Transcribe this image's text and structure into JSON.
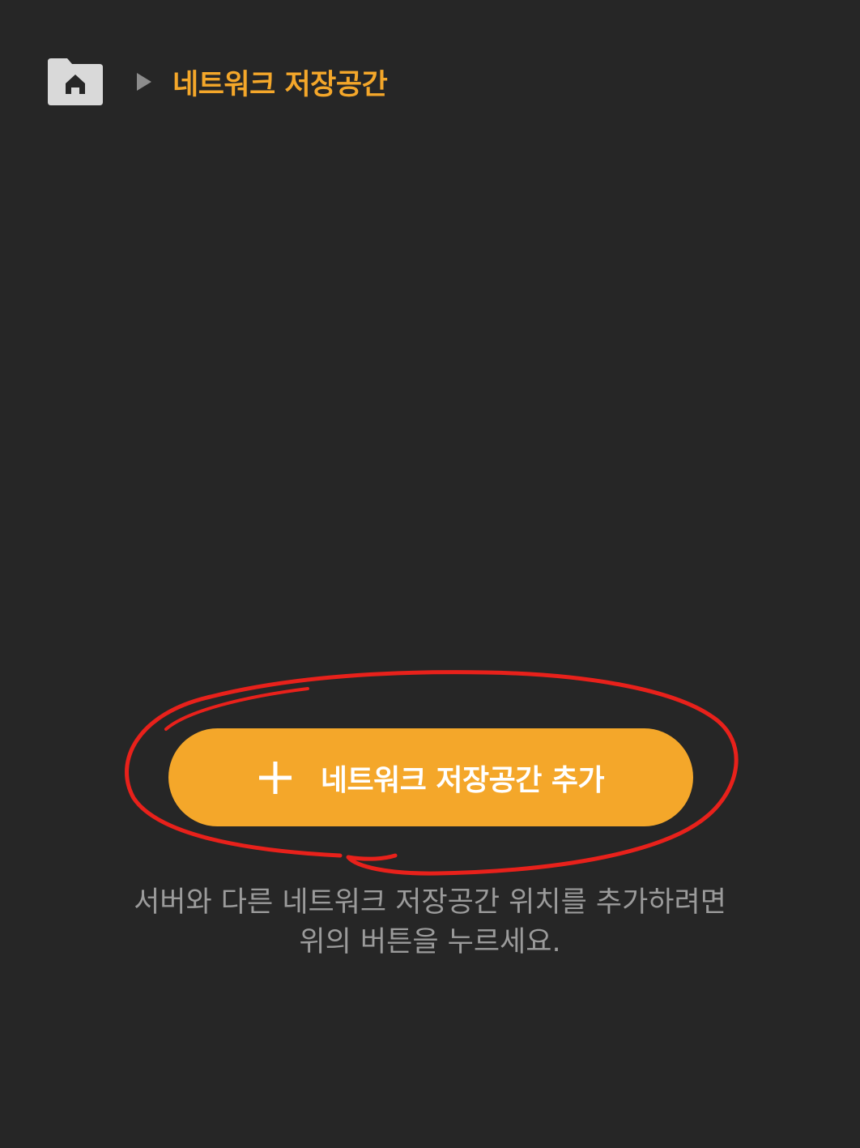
{
  "breadcrumb": {
    "home_icon": "home-folder-icon",
    "separator_icon": "triangle-right-icon",
    "current": "네트워크 저장공간"
  },
  "add_button": {
    "icon": "plus-icon",
    "label": "네트워크 저장공간 추가"
  },
  "hint": {
    "line1": "서버와 다른 네트워크 저장공간 위치를 추가하려면",
    "line2": "위의 버튼을 누르세요."
  },
  "annotation": {
    "highlight": "red-hand-drawn-ellipse"
  },
  "colors": {
    "background": "#262626",
    "accent": "#f4a72a",
    "button_text": "#ffffff",
    "hint_text": "#9b9b9b",
    "home_icon_bg": "#d9d9d9",
    "annotation": "#e8211b"
  }
}
